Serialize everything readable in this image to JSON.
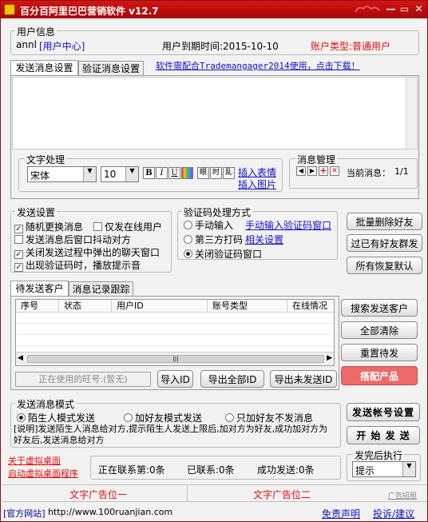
{
  "window": {
    "title": "百分百阿里巴巴营销软件 v12.7",
    "min": "—",
    "max": "▭",
    "close": "✕"
  },
  "user_info": {
    "group_title": "用户信息",
    "username": "annl",
    "user_center": "[用户中心]",
    "expiry": "用户到期时间:2015-10-10",
    "account_type": "账户类型:普通用户"
  },
  "msg_tabs": {
    "send": "发送消息设置",
    "verify": "验证消息设置",
    "notice": "软件需配合Trademangager2014使用，点击下载！"
  },
  "text_proc": {
    "title": "文字处理",
    "font": "宋体",
    "size": "10",
    "bold": "B",
    "italic": "I",
    "underline": "U",
    "tool1": "眼",
    "tool2": "时",
    "tool3": "乱",
    "insert_emoji": "插入表情",
    "insert_image": "插入图片"
  },
  "msg_mgmt": {
    "title": "消息管理",
    "current_label": "当前消息：",
    "current_value": "1/1"
  },
  "send_settings": {
    "title": "发送设置",
    "opt1": "随机更换消息",
    "opt2": "仅发在线用户",
    "opt3": "发送消息后窗口抖动对方",
    "opt4": "关闭发送过程中弹出的聊天窗口",
    "opt5": "出现验证码时，播放提示音"
  },
  "captcha": {
    "title": "验证码处理方式",
    "manual": "手动输入",
    "manual_link": "手动输入验证码窗口",
    "third": "第三方打码",
    "third_link": "相关设置",
    "close": "关闭验证码窗口"
  },
  "right_buttons": {
    "batch_delete": "批量删除好友",
    "already_friend": "过已有好友群发",
    "restore": "所有恢复默认"
  },
  "customer_tabs": {
    "pending": "待发送客户",
    "history": "消息记录跟踪"
  },
  "table": {
    "headers": [
      "序号",
      "状态",
      "用户ID",
      "账号类型",
      "在线情况"
    ]
  },
  "list_buttons": {
    "search": "搜索发送客户",
    "clear": "全部清除",
    "reset": "重置待发",
    "match": "搭配产品"
  },
  "bottom_row": {
    "current_account": "正在使用的旺号:(暂无)",
    "import": "导入ID",
    "export_all": "导出全部ID",
    "export_unsent": "导出未发送ID"
  },
  "mode": {
    "title": "发送消息模式",
    "stranger": "陌生人模式发送",
    "friend": "加好友模式发送",
    "friend_only": "只加好友不发消息",
    "desc": "[说明]发送陌生人消息给对方,提示陌生人发送上限后,加对方为好友,成功加对方为好友后,发送消息给对方"
  },
  "action_buttons": {
    "account_settings": "发送帐号设置",
    "start": "开 始 发 送"
  },
  "after_send": {
    "title": "发完后执行",
    "value": "提示"
  },
  "status_bar": {
    "about_desktop": "关于虚拟桌面",
    "start_desktop": "启动虚拟桌面程序",
    "contacting": "正在联系第:0条",
    "contacted": "已联系:0条",
    "success": "成功发送:0条"
  },
  "ads": {
    "ad1": "文字广告位一",
    "ad2": "文字广告位二",
    "recruit": "广告招租"
  },
  "footer": {
    "site_label": "[官方网站]",
    "site_url": "http://www.100ruanjian.com",
    "disclaimer": "免责声明",
    "feedback": "投诉/建议"
  },
  "colors": {
    "title_red": "#c41010",
    "link_blue": "#1010c8",
    "accent_red": "#e01010",
    "match_button": "#ee6a6a"
  }
}
